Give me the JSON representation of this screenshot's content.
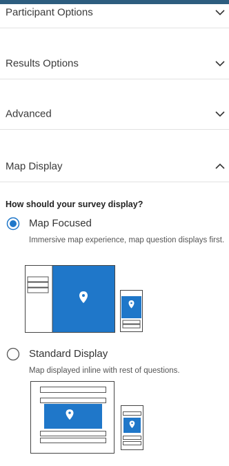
{
  "accordion": {
    "items": [
      {
        "label": "Participant Options",
        "expanded": false
      },
      {
        "label": "Results Options",
        "expanded": false
      },
      {
        "label": "Advanced",
        "expanded": false
      },
      {
        "label": "Map Display",
        "expanded": true
      }
    ]
  },
  "map_display": {
    "question": "How should your survey display?",
    "options": [
      {
        "label": "Map Focused",
        "description": "Immersive map experience, map question displays first.",
        "selected": true
      },
      {
        "label": "Standard Display",
        "description": "Map displayed inline with rest of questions.",
        "selected": false
      }
    ]
  },
  "colors": {
    "accent": "#1f77c9",
    "header_bar": "#2d5d7f",
    "divider": "#e2e2e2"
  },
  "icons": {
    "collapsed": "chevron-down-icon",
    "expanded": "chevron-up-icon",
    "map_pin": "map-pin-icon"
  }
}
